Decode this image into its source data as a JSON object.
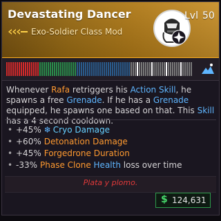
{
  "item": {
    "name": "Devastating Dancer",
    "type": "Exo-Soldier Class Mod",
    "level_label": "Lvl",
    "level": "50",
    "class_icon": "helmet-icon",
    "badge_icon": "skill-badge-icon",
    "rarity_color": "#c8902a"
  },
  "strip": {
    "bar_colors": [
      "#d02a2a",
      "#2a8a4a",
      "#2a5a8a",
      "#ffffff",
      "#7a7a7a"
    ],
    "icon": "mountain-tree-icon"
  },
  "description": {
    "p1": "Whenever ",
    "name1": "Rafa",
    "p2": " retriggers his ",
    "skill1": "Action Skill",
    "p3": ", he spawns a free ",
    "grenade1": "Grenade",
    "p4": ". If he has a ",
    "grenade2": "Grenade",
    "p5": " equipped, he spawns one based on that. This ",
    "skill2": "Skill",
    "p6": " has a 4 second cooldown."
  },
  "stats": [
    {
      "value": "+45%",
      "icon": "snowflake-icon",
      "label": "Cryo Damage",
      "color": "#66d0ff"
    },
    {
      "value": "+60%",
      "label": "Detonation Damage",
      "color": "#ff9a30"
    },
    {
      "value": "+45%",
      "label": "Forgedrone Duration",
      "color": "#ff9a30"
    },
    {
      "value": "-33%",
      "label_a": "Phase Clone",
      "label_b": "Health",
      "label_c": "loss over time"
    }
  ],
  "flavor_text": "Plata y plomo.",
  "price": {
    "currency_symbol": "$",
    "value": "124,631"
  }
}
